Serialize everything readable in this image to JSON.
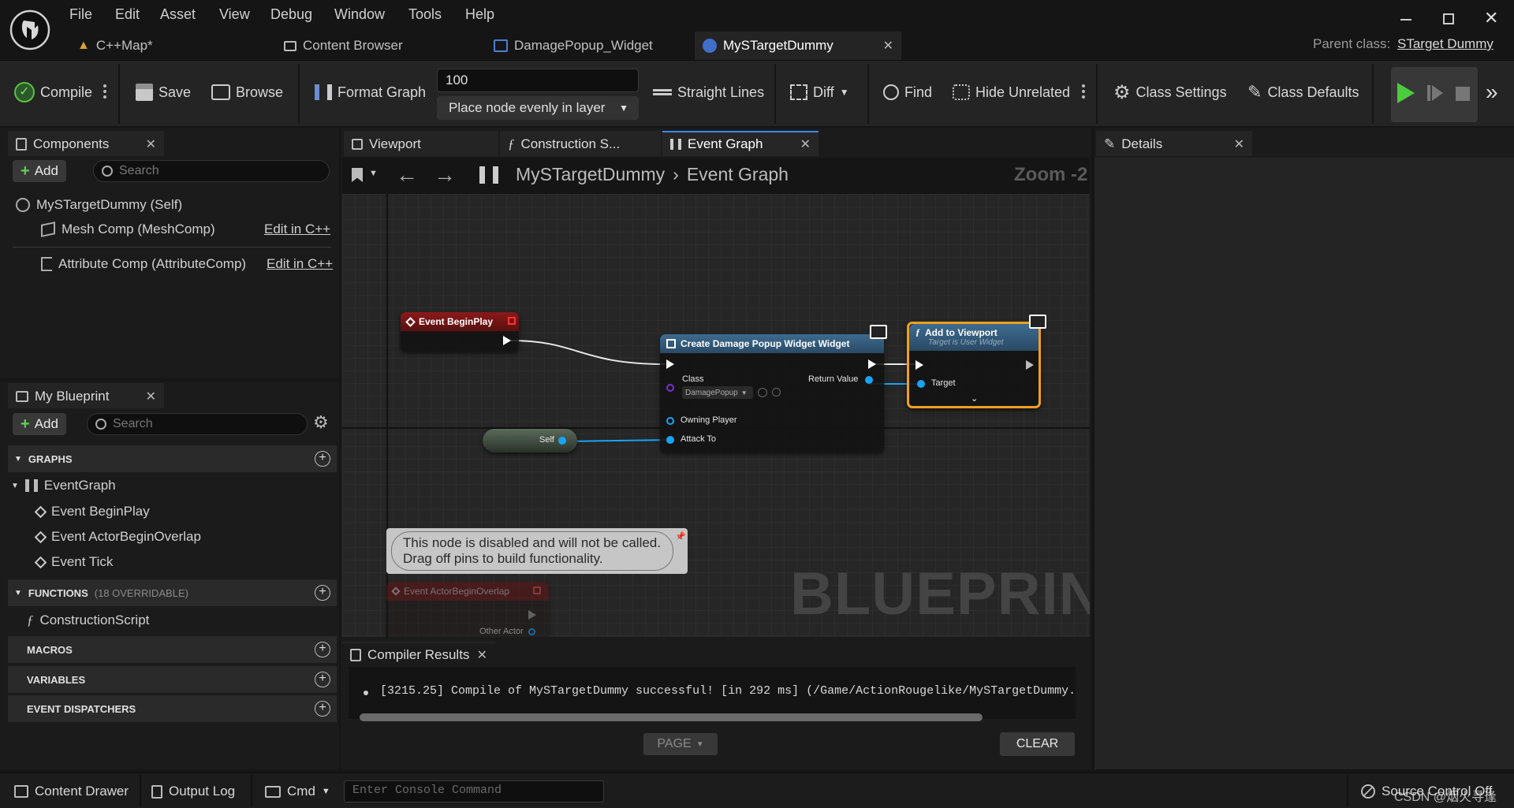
{
  "menu": [
    "File",
    "Edit",
    "Asset",
    "View",
    "Debug",
    "Window",
    "Tools",
    "Help"
  ],
  "doc_tabs": [
    {
      "label": "C++Map*"
    },
    {
      "label": "Content Browser"
    },
    {
      "label": "DamagePopup_Widget"
    },
    {
      "label": "MySTargetDummy"
    }
  ],
  "parent_class": {
    "label": "Parent class:",
    "value": "STarget Dummy"
  },
  "toolbar": {
    "compile": "Compile",
    "save": "Save",
    "browse": "Browse",
    "format_graph": "Format Graph",
    "spacing_value": "100",
    "layout_mode": "Place node evenly in layer",
    "straight_lines": "Straight Lines",
    "diff": "Diff",
    "find": "Find",
    "hide_unrelated": "Hide Unrelated",
    "class_settings": "Class Settings",
    "class_defaults": "Class Defaults"
  },
  "components_panel": {
    "tab": "Components",
    "add": "Add",
    "search_placeholder": "Search",
    "root": "MySTargetDummy (Self)",
    "items": [
      {
        "label": "Mesh Comp (MeshComp)",
        "link": "Edit in C++"
      },
      {
        "label": "Attribute Comp (AttributeComp)",
        "link": "Edit in C++"
      }
    ]
  },
  "my_blueprint": {
    "tab": "My Blueprint",
    "add": "Add",
    "search_placeholder": "Search",
    "graphs_header": "GRAPHS",
    "event_graph": "EventGraph",
    "events": [
      "Event BeginPlay",
      "Event ActorBeginOverlap",
      "Event Tick"
    ],
    "functions_header": "FUNCTIONS",
    "functions_sub": "(18 OVERRIDABLE)",
    "construction_script": "ConstructionScript",
    "macros_header": "MACROS",
    "variables_header": "VARIABLES",
    "dispatchers_header": "EVENT DISPATCHERS"
  },
  "editor_tabs": [
    {
      "label": "Viewport"
    },
    {
      "label": "Construction S..."
    },
    {
      "label": "Event Graph"
    }
  ],
  "graph": {
    "breadcrumb_root": "MySTargetDummy",
    "breadcrumb_leaf": "Event Graph",
    "zoom": "Zoom -2",
    "watermark": "BLUEPRINT",
    "nodes": {
      "begin_play": "Event BeginPlay",
      "create_widget": {
        "title": "Create Damage Popup Widget Widget",
        "class_label": "Class",
        "class_value": "DamagePopup",
        "return_value": "Return Value",
        "owning_player": "Owning Player",
        "attack_to": "Attack To"
      },
      "add_to_viewport": {
        "title": "Add to Viewport",
        "subtitle": "Target is User Widget",
        "target": "Target"
      },
      "self": "Self",
      "disabled_comment_1": "This node is disabled and will not be called.",
      "disabled_comment_2": "Drag off pins to build functionality.",
      "actor_overlap": "Event ActorBeginOverlap",
      "other_actor": "Other Actor"
    }
  },
  "details_panel": {
    "tab": "Details"
  },
  "compiler": {
    "tab": "Compiler Results",
    "message": "[3215.25] Compile of MySTargetDummy successful! [in 292 ms] (/Game/ActionRougelike/MySTargetDummy.",
    "page": "PAGE",
    "clear": "CLEAR"
  },
  "statusbar": {
    "content_drawer": "Content Drawer",
    "output_log": "Output Log",
    "cmd": "Cmd",
    "console_placeholder": "Enter Console Command",
    "source_control": "Source Control Off",
    "watermark": "CSDN @烟火寻逢"
  },
  "colors": {
    "accent": "#3b8ae6",
    "event_node": "#8b1a1a",
    "function_node": "#3d6b8f",
    "selection": "#f0a020",
    "pin_object": "#17a4f5",
    "play_green": "#4ccc3c"
  }
}
